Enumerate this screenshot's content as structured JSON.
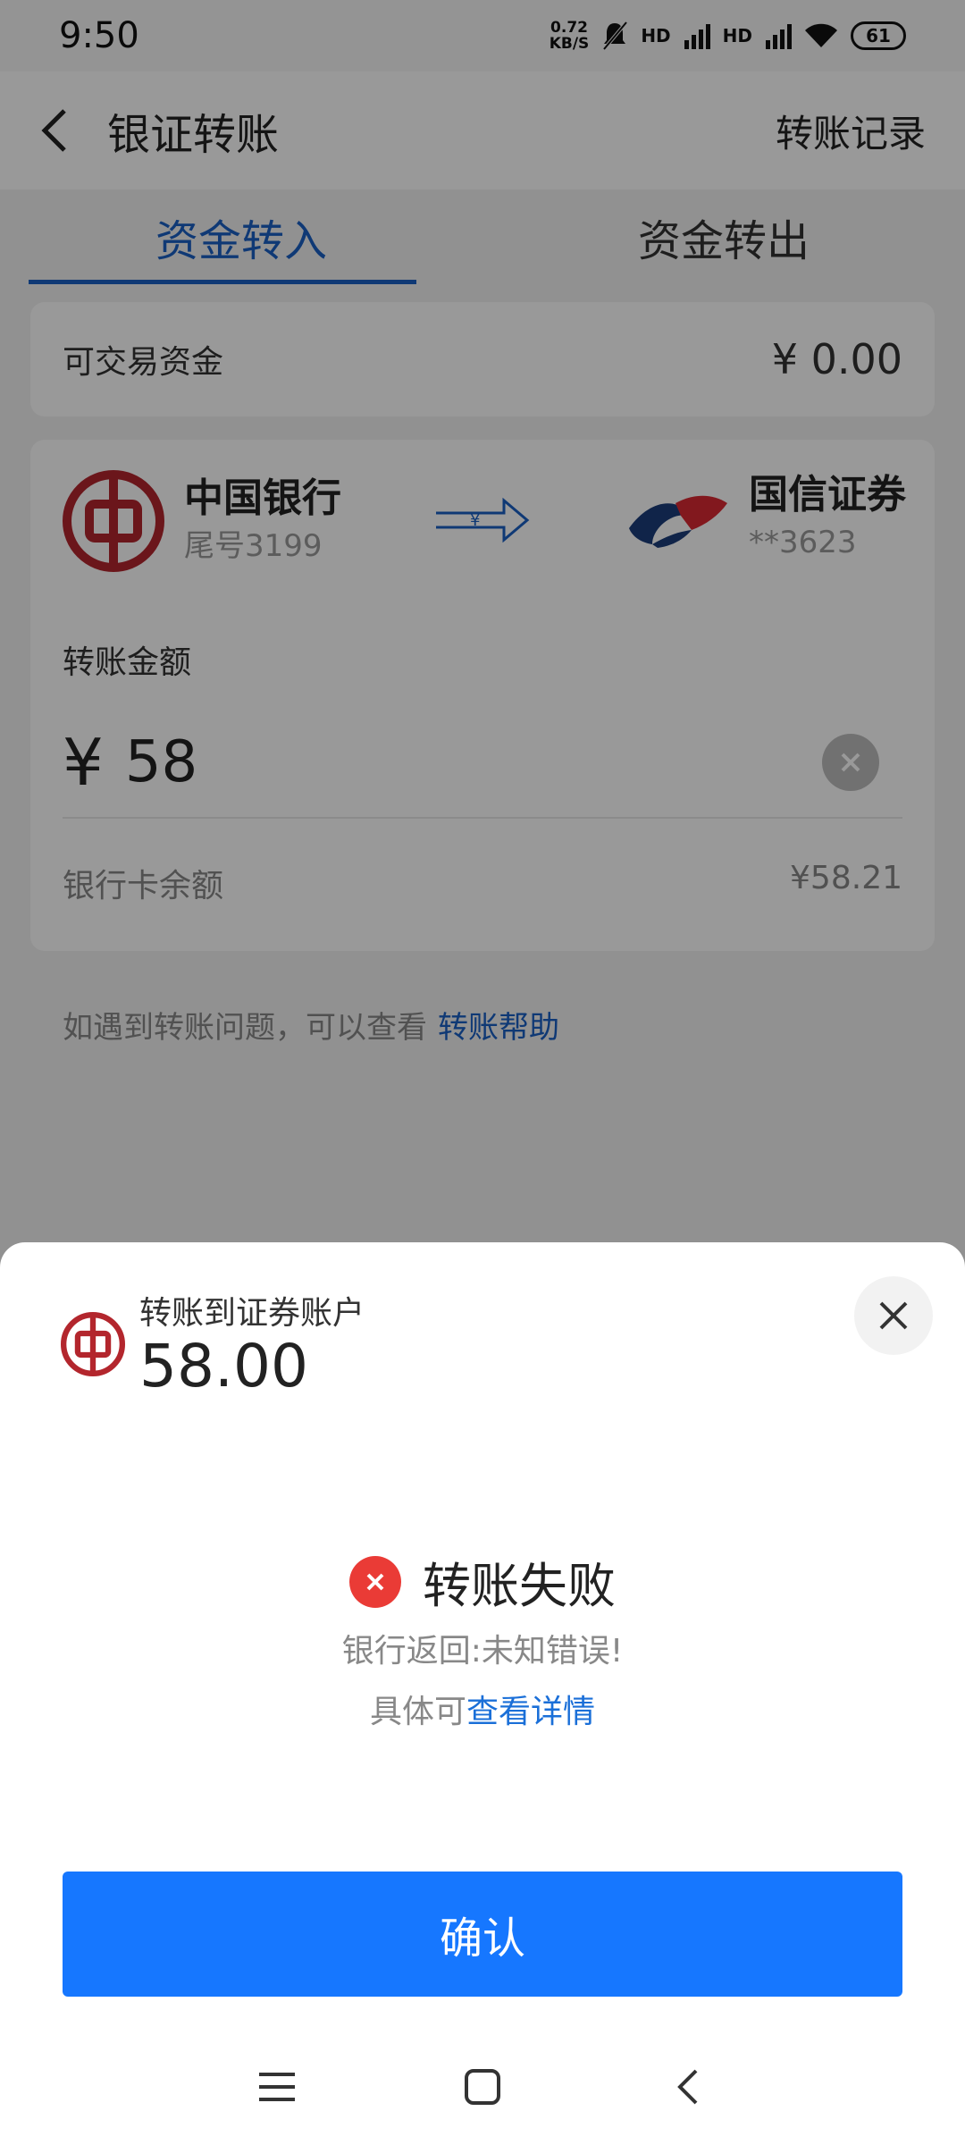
{
  "status_bar": {
    "time": "9:50",
    "net_speed_top": "0.72",
    "net_speed_bottom": "KB/S",
    "signal1": "HD",
    "signal2": "HD",
    "battery": "61"
  },
  "nav": {
    "title": "银证转账",
    "right_link": "转账记录"
  },
  "tabs": [
    {
      "label": "资金转入",
      "active": true
    },
    {
      "label": "资金转出",
      "active": false
    }
  ],
  "balance": {
    "label": "可交易资金",
    "value": "¥ 0.00"
  },
  "transfer": {
    "from": {
      "name": "中国银行",
      "sub": "尾号3199"
    },
    "arrow_symbol": "¥",
    "to": {
      "name": "国信证券",
      "sub": "**3623"
    },
    "amount_label": "转账金额",
    "currency_sign": "¥",
    "amount": "58",
    "card_balance_label": "银行卡余额",
    "card_balance_value": "¥58.21"
  },
  "help": {
    "text": "如遇到转账问题，可以查看",
    "link": "转账帮助"
  },
  "sheet": {
    "subtitle": "转账到证券账户",
    "amount": "58.00",
    "status": "转账失败",
    "message": "银行返回:未知错误!",
    "detail_prefix": "具体可",
    "detail_link": "查看详情",
    "confirm": "确认"
  },
  "colors": {
    "accent": "#1a5fc4",
    "button": "#1677ff",
    "error": "#ea3b36",
    "boc_red": "#b3262d",
    "guosen_red": "#d92832",
    "guosen_navy": "#1b3d7a"
  },
  "icons": [
    "back-icon",
    "boc-logo-icon",
    "transfer-arrow-icon",
    "guosen-logo-icon",
    "clear-icon",
    "close-icon",
    "error-icon",
    "menu-icon",
    "home-icon",
    "nav-back-icon"
  ]
}
